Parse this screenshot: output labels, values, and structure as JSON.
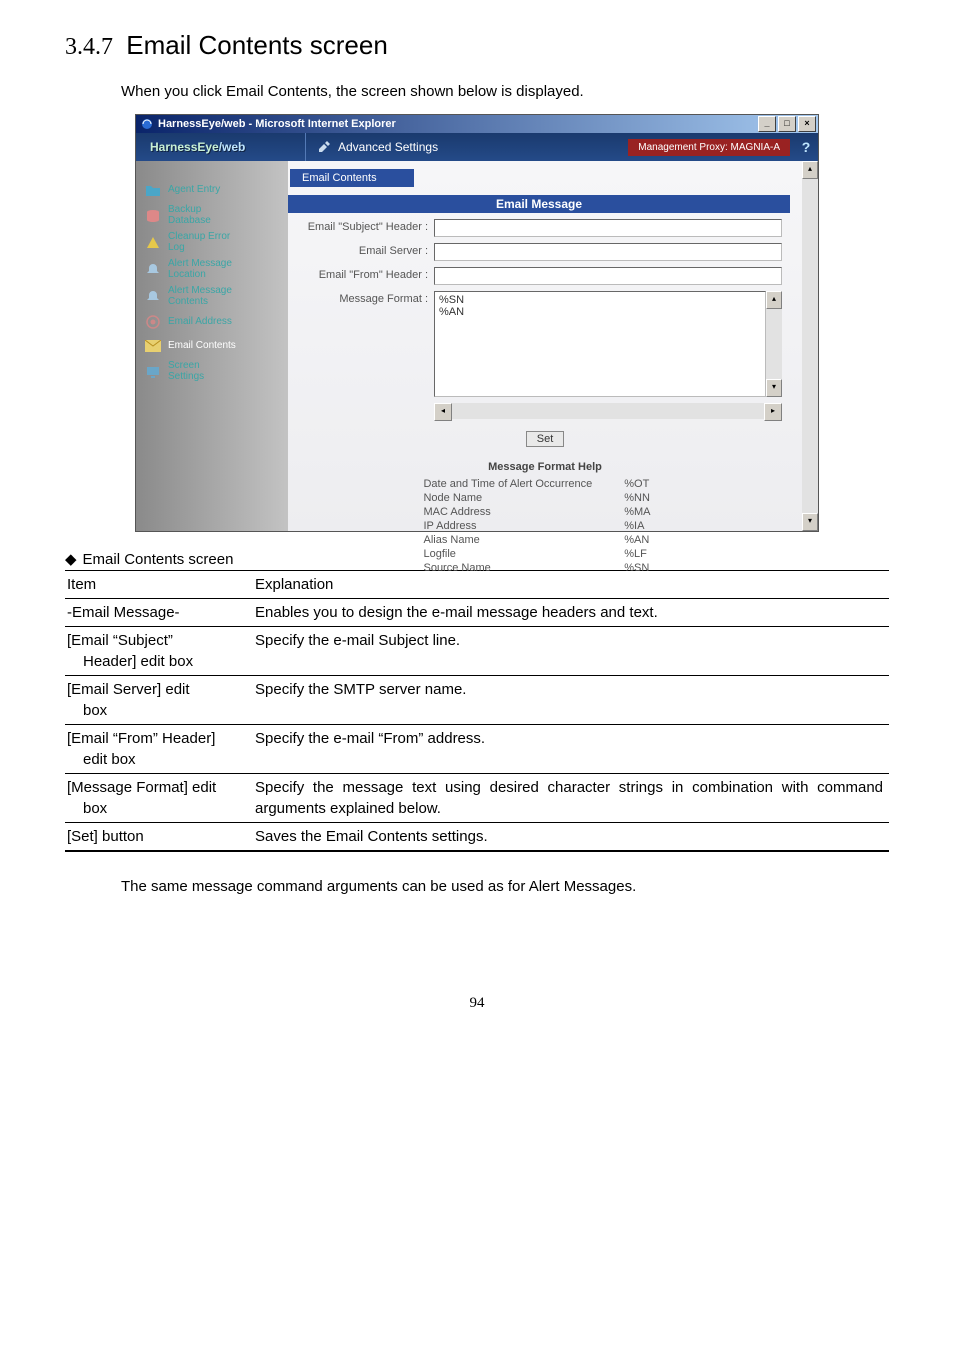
{
  "heading": {
    "num": "3.4.7",
    "title": "Email Contents screen"
  },
  "intro": "When you click Email Contents, the screen shown below is displayed.",
  "window_title": "HarnessEye/web - Microsoft Internet Explorer",
  "brand": {
    "a": "HarnessEye",
    "b": "/web"
  },
  "adv_settings": "Advanced Settings",
  "proxy": "Management Proxy: MAGNIA-A",
  "help_icon": "?",
  "sidebar": {
    "items": [
      {
        "label": "Agent Entry",
        "white": false
      },
      {
        "label": "Backup\nDatabase",
        "white": false
      },
      {
        "label": "Cleanup Error\nLog",
        "white": false
      },
      {
        "label": "Alert Message\nLocation",
        "white": false
      },
      {
        "label": "Alert Message\nContents",
        "white": false
      },
      {
        "label": "Email Address",
        "white": false
      },
      {
        "label": "Email Contents",
        "white": true
      },
      {
        "label": "Screen\nSettings",
        "white": false
      }
    ]
  },
  "ec_chip": "Email Contents",
  "banner": "Email Message",
  "form": {
    "subject_label": "Email \"Subject\" Header :",
    "server_label": "Email Server :",
    "from_label": "Email \"From\" Header :",
    "format_label": "Message Format :",
    "format_value": "%SN\n%AN"
  },
  "set_btn": "Set",
  "help_title": "Message Format Help",
  "help_rows": [
    {
      "k": "Date and Time of Alert Occurrence",
      "v": "%OT"
    },
    {
      "k": "Node Name",
      "v": "%NN"
    },
    {
      "k": "MAC Address",
      "v": "%MA"
    },
    {
      "k": "IP Address",
      "v": "%IA"
    },
    {
      "k": "Alias Name",
      "v": "%AN"
    },
    {
      "k": "Logfile",
      "v": "%LF"
    },
    {
      "k": "Source Name",
      "v": "%SN"
    }
  ],
  "tbl_caption": "Email Contents screen",
  "tbl_headers": {
    "item": "Item",
    "expl": "Explanation"
  },
  "tbl_rows": [
    {
      "item": "-Email Message-",
      "expl": "Enables you to design the e-mail message headers and text."
    },
    {
      "item_a": "[Email “Subject”",
      "item_b": "Header] edit box",
      "expl": "Specify the e-mail Subject line."
    },
    {
      "item_a": "[Email Server] edit",
      "item_b": "box",
      "expl": "Specify the SMTP server name."
    },
    {
      "item_a": "[Email “From” Header]",
      "item_b": "edit box",
      "expl": "Specify the e-mail “From” address."
    },
    {
      "item_a": "[Message Format] edit",
      "item_b": "box",
      "expl": "Specify the message text using desired character strings in combination with command arguments explained below."
    },
    {
      "item": "[Set] button",
      "expl": "Saves the Email Contents settings."
    }
  ],
  "footer_note": "The same message command arguments can be used as for Alert Messages.",
  "page_num": "94"
}
